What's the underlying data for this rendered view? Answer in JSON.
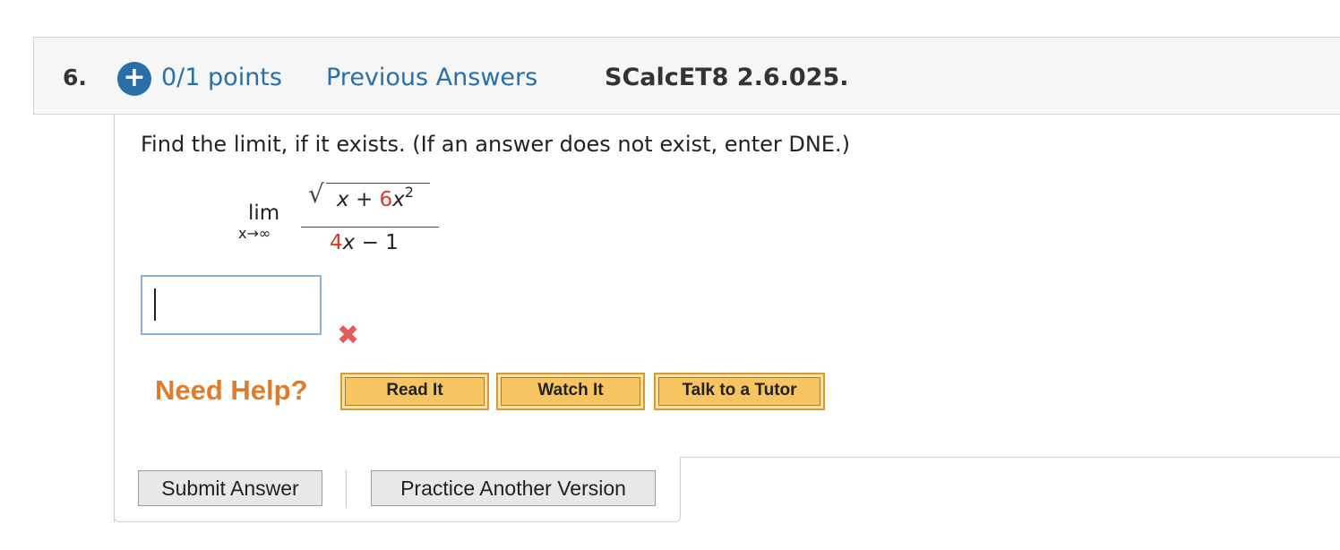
{
  "question": {
    "number": "6.",
    "points": "0/1 points",
    "previous_answers": "Previous Answers",
    "code": "SCalcET8 2.6.025."
  },
  "problem": {
    "instruction": "Find the limit, if it exists. (If an answer does not exist, enter DNE.)",
    "limit_label": "lim",
    "limit_sub": "x→∞",
    "numerator": {
      "x": "x",
      "plus": "+",
      "coef": "6",
      "var": "x",
      "exp": "2"
    },
    "denominator": {
      "coef": "4",
      "var": "x",
      "minus": "−",
      "const": "1"
    }
  },
  "answer": {
    "value": "",
    "status": "incorrect",
    "status_icon": "x-mark-icon"
  },
  "help": {
    "label": "Need Help?",
    "read_it": "Read It",
    "watch_it": "Watch It",
    "tutor": "Talk to a Tutor"
  },
  "actions": {
    "submit": "Submit Answer",
    "practice": "Practice Another Version"
  },
  "colors": {
    "accent_blue": "#2a6fa8",
    "highlight_red": "#e0371f",
    "help_orange": "#e07b2c",
    "error_red": "#e85a5a"
  }
}
